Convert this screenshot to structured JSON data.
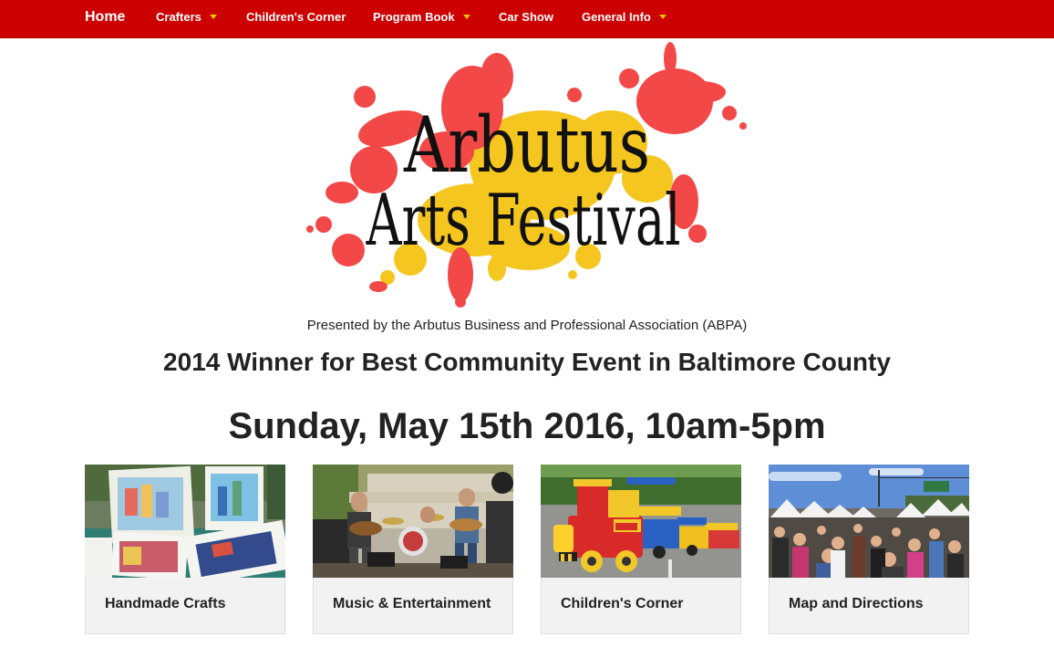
{
  "nav": {
    "home": "Home",
    "crafters": "Crafters",
    "childrens_corner": "Children's Corner",
    "program_book": "Program Book",
    "car_show": "Car Show",
    "general_info": "General Info"
  },
  "logo": {
    "line1": "Arbutus",
    "line2": "Arts Festival"
  },
  "presented_by": "Presented by the Arbutus Business and Professional Association (ABPA)",
  "award": "2014 Winner for Best Community Event in Baltimore County",
  "event_date": "Sunday, May 15th 2016, 10am-5pm",
  "cards": [
    {
      "caption": "Handmade Crafts"
    },
    {
      "caption": "Music & Entertainment"
    },
    {
      "caption": "Children's Corner"
    },
    {
      "caption": "Map and Directions"
    }
  ],
  "colors": {
    "nav_bg": "#cc0000",
    "caret": "#f5c400",
    "splash_red": "#f24848",
    "splash_yellow": "#f5c61f",
    "card_bg": "#f2f2f2"
  }
}
